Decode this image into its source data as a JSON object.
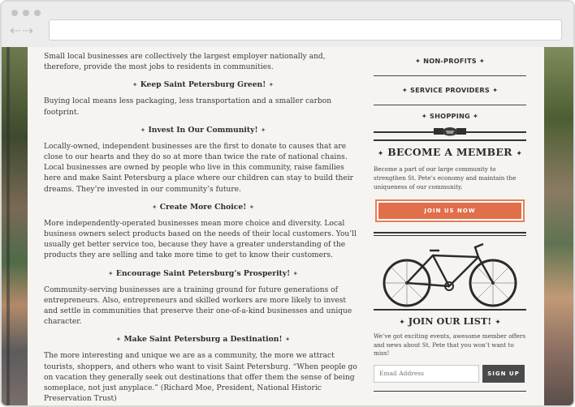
{
  "browser": {
    "back_forward_glyph": "⇠⇢",
    "address": ""
  },
  "main": {
    "intro": "Small local businesses are collectively the largest employer nationally and, therefore, provide the most jobs to residents in communities.",
    "sections": [
      {
        "heading": "Keep Saint Petersburg Green!",
        "body": "Buying local means less packaging, less transportation and a smaller carbon footprint."
      },
      {
        "heading": "Invest In Our Community!",
        "body": "Locally-owned, independent businesses are the first to donate to causes that are close to our hearts and they do so at more than twice the rate of national chains. Local businesses are owned by people who live in this community, raise families here and make Saint Petersburg a place where our children can stay to build their dreams. They’re invested in our community’s future."
      },
      {
        "heading": "Create More Choice!",
        "body": "More independently-operated businesses mean more choice and diversity. Local business owners select products based on the needs of their local customers. You’ll usually get better service too, because they have a greater understanding of the products they are selling and take more time to get to know their customers."
      },
      {
        "heading": "Encourage Saint Petersburg’s Prosperity!",
        "body": "Community-serving businesses are a training ground for future generations of entrepreneurs. Also, entrepreneurs and skilled workers are more likely to invest and settle in communities that preserve their one-of-a-kind businesses and unique character."
      },
      {
        "heading": "Make Saint Petersburg a Destination!",
        "body": "The more interesting and unique we are as a community, the more we attract tourists, shoppers, and others who want to visit Saint Petersburg. “When people go on vacation they generally seek out destinations that offer them the sense of being someplace, not just anyplace.” (Richard Moe, President, National Historic Preservation Trust)"
      }
    ],
    "ornament_left": "✦",
    "ornament_right": "✦"
  },
  "sidebar": {
    "categories": [
      {
        "label": "NON-PROFITS"
      },
      {
        "label": "SERVICE PROVIDERS"
      },
      {
        "label": "SHOPPING"
      }
    ],
    "member": {
      "title": "BECOME A MEMBER",
      "text": "Become a part of our large community to strengthen St. Pete’s economy and maintain the uniqueness of our community.",
      "button": "JOIN US NOW"
    },
    "list": {
      "title": "JOIN OUR LIST!",
      "text": "We’ve got exciting events, awesome member offers and news about St. Pete that you won’t want to miss!",
      "email_placeholder": "Email Address",
      "signup": "SIGN UP"
    }
  },
  "colors": {
    "accent": "#e06f4a",
    "paper": "#f6f4f0",
    "dark": "#333333"
  },
  "icons": [
    "handshake-icon",
    "bicycle-icon",
    "ornament-icon"
  ]
}
